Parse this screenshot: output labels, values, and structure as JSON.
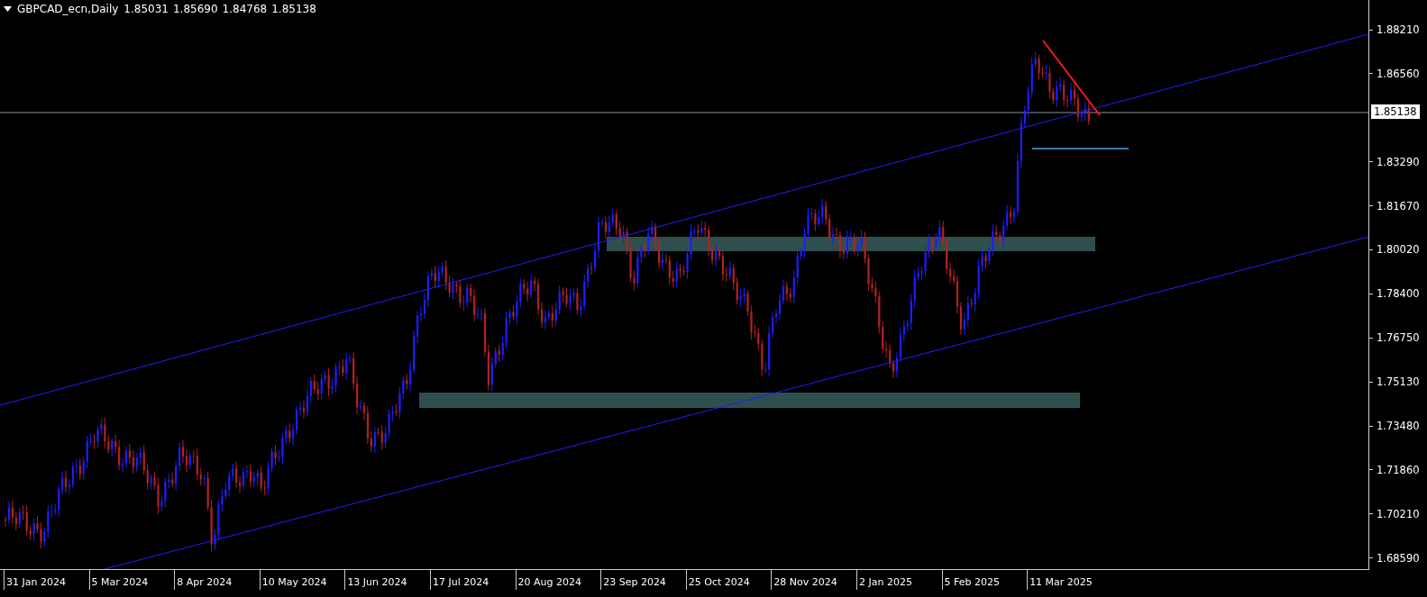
{
  "symbol_bar": {
    "title": "GBPCAD_ecn,Daily",
    "quotes": [
      "1.85031",
      "1.85690",
      "1.84768",
      "1.85138"
    ]
  },
  "price_axis": {
    "labels": [
      "1.88210",
      "1.86560",
      "1.83290",
      "1.81670",
      "1.80020",
      "1.78400",
      "1.76750",
      "1.75130",
      "1.73480",
      "1.71860",
      "1.70210",
      "1.68590"
    ],
    "current_price": "1.85138"
  },
  "time_axis": {
    "labels": [
      "31 Jan 2024",
      "5 Mar 2024",
      "8 Apr 2024",
      "10 May 2024",
      "13 Jun 2024",
      "17 Jul 2024",
      "20 Aug 2024",
      "23 Sep 2024",
      "25 Oct 2024",
      "28 Nov 2024",
      "2 Jan 2025",
      "5 Feb 2025",
      "11 Mar 2025"
    ]
  }
}
